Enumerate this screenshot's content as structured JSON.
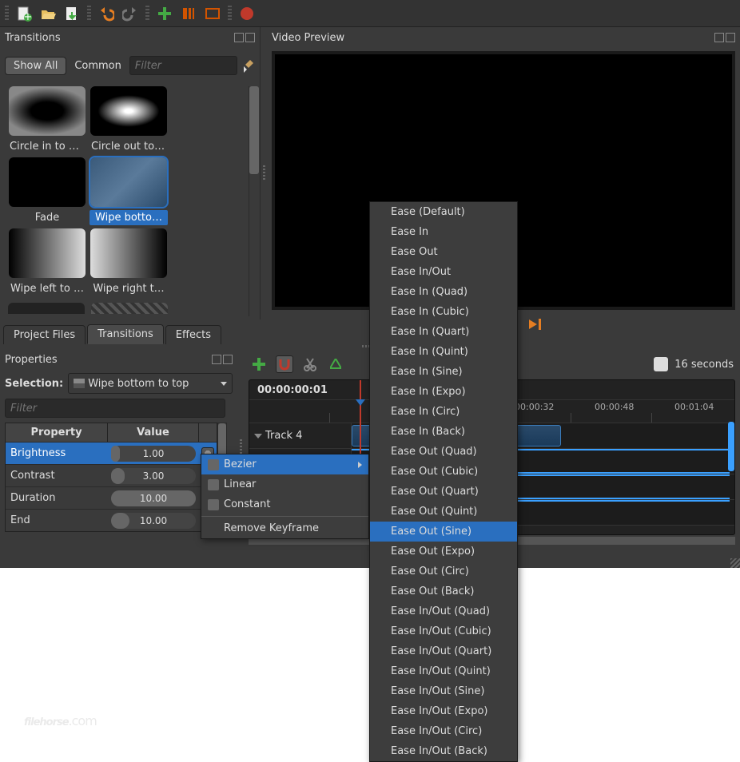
{
  "toolbar": {
    "icons": [
      "new-file-icon",
      "open-file-icon",
      "save-file-icon",
      "undo-icon",
      "redo-icon",
      "add-icon",
      "toggle-panels-icon",
      "fullscreen-icon",
      "record-icon"
    ]
  },
  "transitions": {
    "title": "Transitions",
    "show_all": "Show All",
    "common": "Common",
    "filter_placeholder": "Filter",
    "items": [
      {
        "label": "Circle in to out",
        "sel": false
      },
      {
        "label": "Circle out to in",
        "sel": false
      },
      {
        "label": "Fade",
        "sel": false
      },
      {
        "label": "Wipe botto…",
        "sel": true
      },
      {
        "label": "Wipe left to …",
        "sel": false
      },
      {
        "label": "Wipe right t…",
        "sel": false
      }
    ],
    "extra_row": true
  },
  "preview": {
    "title": "Video Preview"
  },
  "tabs": [
    {
      "label": "Project Files",
      "active": false
    },
    {
      "label": "Transitions",
      "active": true
    },
    {
      "label": "Effects",
      "active": false
    }
  ],
  "properties": {
    "title": "Properties",
    "selection_label": "Selection:",
    "selection_value": "Wipe bottom to top",
    "filter_placeholder": "Filter",
    "columns": {
      "c1": "Property",
      "c2": "Value"
    },
    "rows": [
      {
        "name": "Brightness",
        "value": "1.00",
        "fill": 10,
        "sel": true
      },
      {
        "name": "Contrast",
        "value": "3.00",
        "fill": 16,
        "sel": false
      },
      {
        "name": "Duration",
        "value": "10.00",
        "fill": 100,
        "sel": false
      },
      {
        "name": "End",
        "value": "10.00",
        "fill": 22,
        "sel": false
      }
    ]
  },
  "timeline": {
    "timecode": "00:00:00:01",
    "zoom_label": "16 seconds",
    "ruler": [
      "00:00:32",
      "00:00:48",
      "00:01:04"
    ],
    "track0": "Track 4"
  },
  "context_menu_1": {
    "items": [
      {
        "label": "Bezier",
        "sub": true,
        "hov": true
      },
      {
        "label": "Linear",
        "sub": false
      },
      {
        "label": "Constant",
        "sub": false
      }
    ],
    "remove": "Remove Keyframe"
  },
  "context_menu_2": {
    "items": [
      "Ease (Default)",
      "Ease In",
      "Ease Out",
      "Ease In/Out",
      "Ease In (Quad)",
      "Ease In (Cubic)",
      "Ease In (Quart)",
      "Ease In (Quint)",
      "Ease In (Sine)",
      "Ease In (Expo)",
      "Ease In (Circ)",
      "Ease In (Back)",
      "Ease Out (Quad)",
      "Ease Out (Cubic)",
      "Ease Out (Quart)",
      "Ease Out (Quint)",
      "Ease Out (Sine)",
      "Ease Out (Expo)",
      "Ease Out (Circ)",
      "Ease Out (Back)",
      "Ease In/Out (Quad)",
      "Ease In/Out (Cubic)",
      "Ease In/Out (Quart)",
      "Ease In/Out (Quint)",
      "Ease In/Out (Sine)",
      "Ease In/Out (Expo)",
      "Ease In/Out (Circ)",
      "Ease In/Out (Back)"
    ],
    "hover_index": 16
  },
  "watermark": {
    "brand": "filehorse",
    "tld": ".com"
  }
}
